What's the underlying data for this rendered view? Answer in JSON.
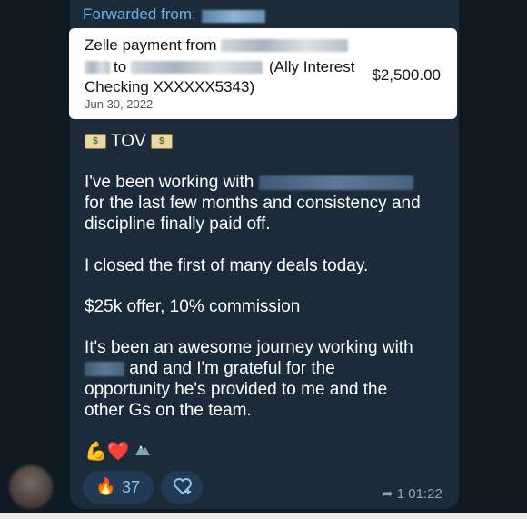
{
  "forward": {
    "label": "Forwarded from:"
  },
  "payment": {
    "line1": "Zelle payment from",
    "line2_to": "to",
    "line2_account": "(Ally Interest",
    "line3": "Checking XXXXXX5343)",
    "date": "Jun 30, 2022",
    "amount": "$2,500.00"
  },
  "message": {
    "title": "TOV",
    "p1_line1": "I've been working with",
    "p1_line2": "for the last few months and consistency and",
    "p1_line3": "discipline finally paid off.",
    "p2": "I closed the first of many deals today.",
    "p3": "$25k offer, 10% commission",
    "p4_line1": "It's been an awesome journey working with",
    "p4_line2": "and and I'm grateful for the",
    "p4_line3": "opportunity he's provided to me and the",
    "p4_line4": "other Gs on the team."
  },
  "emoji_line": "💪❤️",
  "reactions": {
    "fire_count": "37"
  },
  "meta": {
    "forward_count": "1",
    "time": "01:22"
  },
  "icons": [
    "money-emoji-icon",
    "fire-icon",
    "add-reaction-icon",
    "forward-arrow-icon"
  ],
  "colors": {
    "background": "#0f1a23",
    "bubble": "#1c2b39",
    "accent": "#6eaee6"
  }
}
